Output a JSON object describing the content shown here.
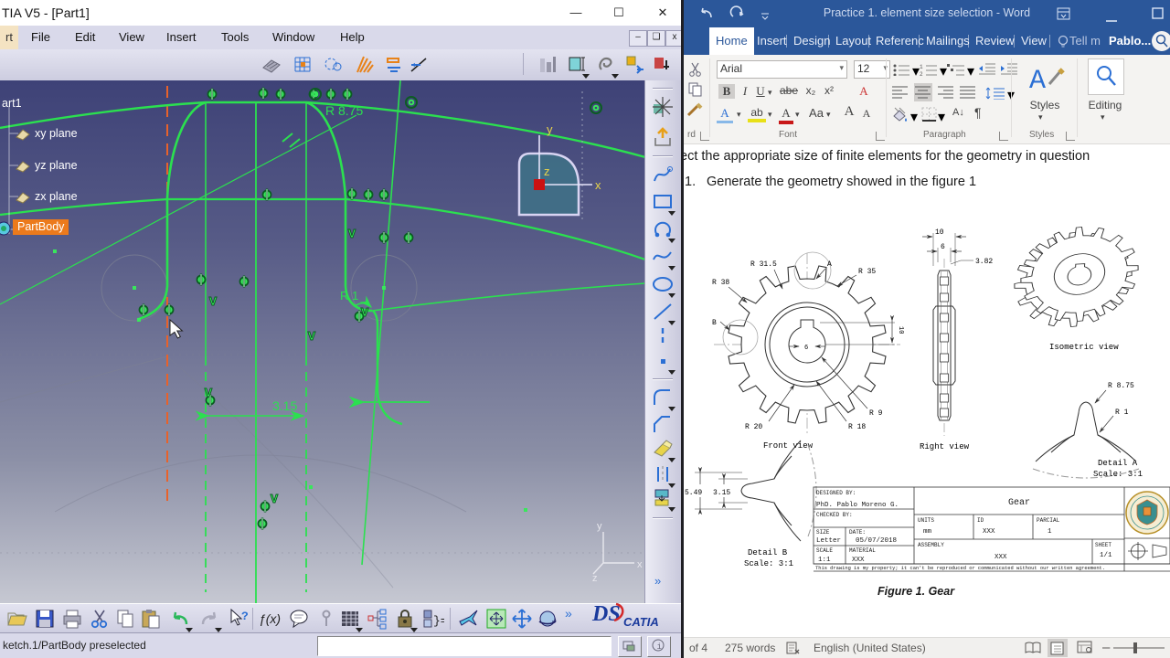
{
  "catia": {
    "title": "TIA V5 - [Part1]",
    "menus": [
      "rt",
      "File",
      "Edit",
      "View",
      "Insert",
      "Tools",
      "Window",
      "Help"
    ],
    "tree": {
      "root": "art1",
      "planes": [
        "xy plane",
        "yz plane",
        "zx plane"
      ],
      "body": "PartBody"
    },
    "sketch": {
      "r875": "R 8.75",
      "r1": "R 1",
      "w315": "3.15",
      "v": "V",
      "compass": {
        "x": "x",
        "y": "y",
        "z": "z"
      },
      "triad": {
        "x": "x",
        "y": "y",
        "z": "z"
      }
    },
    "toolbar": {
      "fx": "ƒ(x)"
    },
    "status": "ketch.1/PartBody preselected",
    "logo": {
      "ds": "DS",
      "catia": "CATIA"
    },
    "colors": {
      "sketch_green": "#2be04f",
      "axis_orange": "#e8622a",
      "select_orange": "#ec7a1c"
    }
  },
  "word": {
    "title": "Practice 1. element size selection - Word",
    "tabs": [
      "Home",
      "Insert",
      "Design",
      "Layout",
      "Referenc",
      "Mailings",
      "Review",
      "View"
    ],
    "tellme": "Tell m",
    "account": "Pablo...",
    "ribbon": {
      "font_name": "Arial",
      "font_size": "12",
      "bold": "B",
      "italic": "I",
      "underline": "U",
      "strike": "abe",
      "sub": "x₂",
      "sup": "x²",
      "clear": "A",
      "effects": "A",
      "highlight": "ab",
      "fontcolor": "A",
      "case": "Aa",
      "grow": "A",
      "shrink": "A",
      "az": "A↓",
      "pilcrow": "¶",
      "styles": "Styles",
      "editing": "Editing",
      "groups": {
        "clipboard": "rd",
        "font": "Font",
        "paragraph": "Paragraph",
        "styles": "Styles"
      }
    },
    "doc": {
      "line1": "ect the appropriate size of finite elements for the geometry in question",
      "item_num": "1.",
      "item_text": "Generate the geometry showed in the figure 1",
      "caption": "Figure 1. Gear"
    },
    "figure": {
      "front": {
        "r315": "R 31.5",
        "a": "A",
        "r35": "R 35",
        "r38": "R 38",
        "b": "B",
        "d6": "6",
        "d10": "10",
        "r9": "R 9",
        "r18": "R 18",
        "r20": "R 20",
        "caption": "Front view"
      },
      "right": {
        "d10": "10",
        "d6": "6",
        "d382": "3.82",
        "caption": "Right view"
      },
      "iso": {
        "caption": "Isometric view"
      },
      "da": {
        "r875": "R 8.75",
        "r1": "R 1",
        "l1": "Detail A",
        "l2": "Scale:  3:1"
      },
      "db": {
        "d549": "5.49",
        "d315": "3.15",
        "l1": "Detail B",
        "l2": "Scale:  3:1"
      },
      "tb": {
        "designed_l": "DESIGNED BY:",
        "designed": "PhD. Pablo Moreno G.",
        "checked_l": "CHECKED BY:",
        "size_l": "SIZE",
        "size": "Letter",
        "date_l": "DATE:",
        "date": "05/07/2018",
        "scale_l": "SCALE",
        "scale": "1:1",
        "material_l": "MATERIAL",
        "material": "XXX",
        "title": "Gear",
        "units_l": "UNITS",
        "units": "mm",
        "id_l": "ID",
        "id": "XXX",
        "parcial_l": "PARCIAL",
        "parcial": "1",
        "assembly_l": "ASSEMBLY",
        "assembly": "XXX",
        "sheet_l": "SHEET",
        "sheet": "1/1",
        "note": "This drawing is my property; it can't be reproduced or communicated without our written agreement."
      }
    },
    "status": {
      "page": "of 4",
      "words": "275 words",
      "lang": "English (United States)"
    }
  }
}
